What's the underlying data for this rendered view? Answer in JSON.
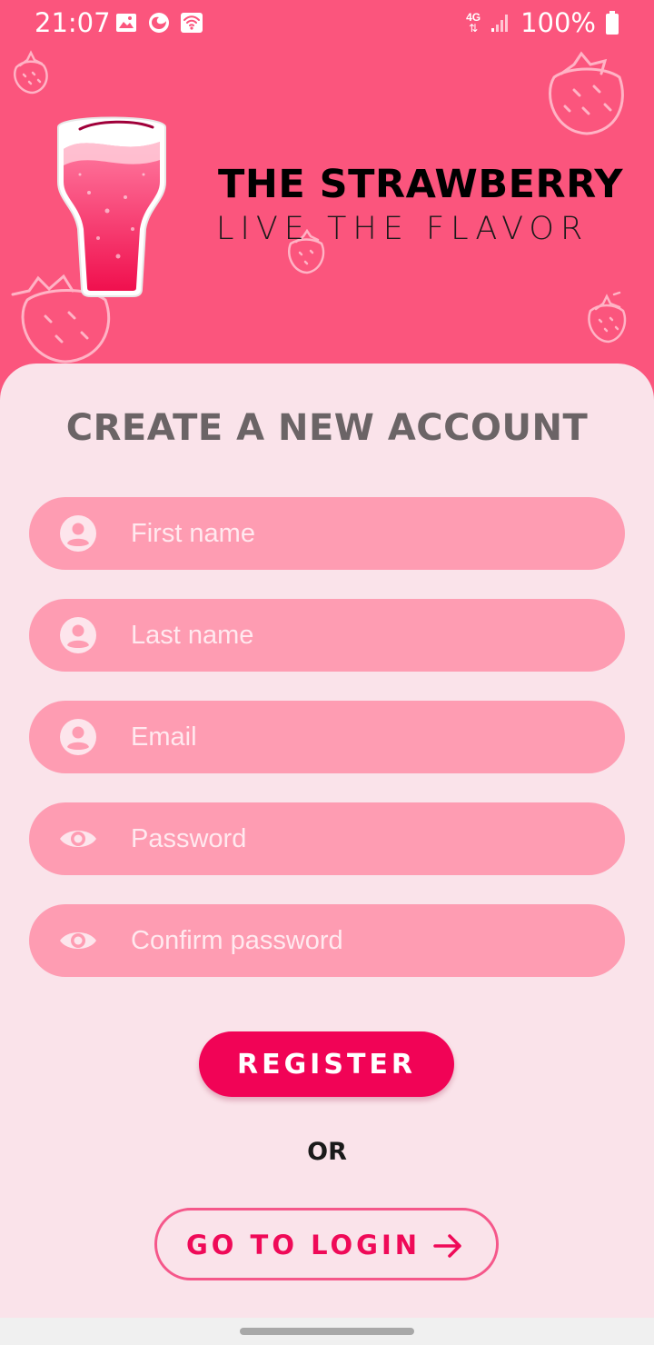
{
  "status_bar": {
    "time": "21:07",
    "network": "4G",
    "battery": "100%",
    "icons": [
      "image-icon",
      "sync-icon",
      "wifi-icon",
      "data-arrows-icon",
      "signal-icon",
      "battery-icon"
    ]
  },
  "brand": {
    "title": "THE STRAWBERRY",
    "tagline": "LIVE THE FLAVOR",
    "logo_icon": "strawberry-drink-glass-icon"
  },
  "form": {
    "title": "CREATE A NEW ACCOUNT",
    "fields": [
      {
        "placeholder": "First name",
        "icon": "user-icon"
      },
      {
        "placeholder": "Last name",
        "icon": "user-icon"
      },
      {
        "placeholder": "Email",
        "icon": "user-icon"
      },
      {
        "placeholder": "Password",
        "icon": "eye-icon"
      },
      {
        "placeholder": "Confirm password",
        "icon": "eye-icon"
      }
    ],
    "register_label": "REGISTER",
    "or_label": "OR",
    "login_label": "GO TO LOGIN"
  },
  "colors": {
    "header_bg": "#fb557d",
    "card_bg": "#fae3ea",
    "field_bg": "#fe9cb2",
    "primary": "#f10356",
    "title_gray": "#6b6466"
  }
}
